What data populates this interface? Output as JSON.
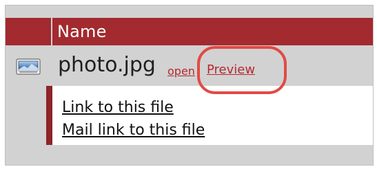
{
  "table": {
    "header": {
      "name": "Name"
    },
    "row": {
      "icon": "image-file-icon",
      "file_name": "photo.jpg",
      "open_label": "open",
      "preview_label": "Preview"
    },
    "menu": [
      {
        "label": "Link to this file"
      },
      {
        "label": "Mail link to this file"
      }
    ]
  },
  "colors": {
    "header": "#a32a2f",
    "link": "#b42a2f",
    "highlight": "#e14a45",
    "panel_accent": "#8e2329",
    "background": "#d2d2d2"
  }
}
